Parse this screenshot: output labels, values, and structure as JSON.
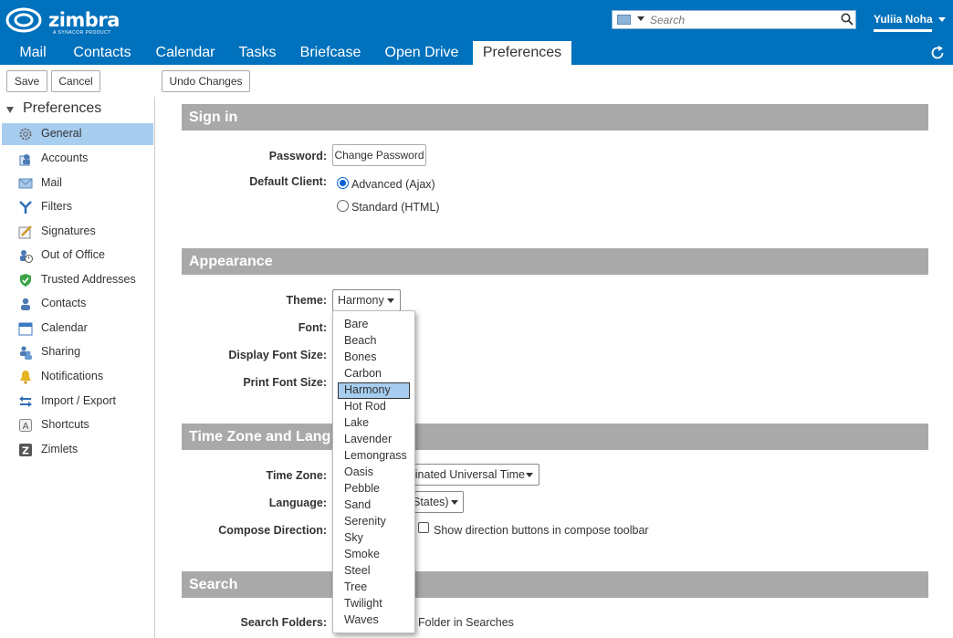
{
  "header": {
    "logo_text": "zimbra",
    "logo_subtext": "A SYNACOR PRODUCT",
    "search_placeholder": "Search",
    "user_name": "Yuliia Noha"
  },
  "tabs": [
    {
      "label": "Mail"
    },
    {
      "label": "Contacts"
    },
    {
      "label": "Calendar"
    },
    {
      "label": "Tasks"
    },
    {
      "label": "Briefcase"
    },
    {
      "label": "Open Drive"
    },
    {
      "label": "Preferences",
      "active": true
    }
  ],
  "toolbar": {
    "save_label": "Save",
    "cancel_label": "Cancel",
    "undo_label": "Undo Changes"
  },
  "sidebar": {
    "header": "Preferences",
    "items": [
      {
        "label": "General",
        "icon": "gear-icon",
        "selected": true
      },
      {
        "label": "Accounts",
        "icon": "accounts-icon"
      },
      {
        "label": "Mail",
        "icon": "mail-icon"
      },
      {
        "label": "Filters",
        "icon": "filter-icon"
      },
      {
        "label": "Signatures",
        "icon": "signature-icon"
      },
      {
        "label": "Out of Office",
        "icon": "out-of-office-icon"
      },
      {
        "label": "Trusted Addresses",
        "icon": "shield-icon"
      },
      {
        "label": "Contacts",
        "icon": "contact-icon"
      },
      {
        "label": "Calendar",
        "icon": "calendar-icon"
      },
      {
        "label": "Sharing",
        "icon": "sharing-icon"
      },
      {
        "label": "Notifications",
        "icon": "bell-icon"
      },
      {
        "label": "Import / Export",
        "icon": "import-export-icon"
      },
      {
        "label": "Shortcuts",
        "icon": "shortcut-icon"
      },
      {
        "label": "Zimlets",
        "icon": "zimlet-icon"
      }
    ]
  },
  "signin": {
    "title": "Sign in",
    "password_label": "Password:",
    "change_password": "Change Password",
    "default_client_label": "Default Client:",
    "advanced": "Advanced (Ajax)",
    "standard": "Standard (HTML)"
  },
  "appearance": {
    "title": "Appearance",
    "theme_label": "Theme:",
    "theme_value": "Harmony",
    "font_label": "Font:",
    "display_font_size_label": "Display Font Size:",
    "print_font_size_label": "Print Font Size:"
  },
  "timezone": {
    "title": "Time Zone and Lang",
    "tz_label": "Time Zone:",
    "tz_value": "linated Universal Time",
    "language_label": "Language:",
    "language_value": "States)",
    "compose_direction_label": "Compose Direction:",
    "compose_direction_text": "Show direction buttons in compose toolbar"
  },
  "search": {
    "title": "Search",
    "folders_label": "Search Folders:",
    "folders_text": "Folder in Searches"
  },
  "theme_options": [
    "Bare",
    "Beach",
    "Bones",
    "Carbon",
    "Harmony",
    "Hot Rod",
    "Lake",
    "Lavender",
    "Lemongrass",
    "Oasis",
    "Pebble",
    "Sand",
    "Serenity",
    "Sky",
    "Smoke",
    "Steel",
    "Tree",
    "Twilight",
    "Waves"
  ],
  "theme_selected": "Harmony",
  "colors": {
    "brand_blue": "#0071bc",
    "section_gray": "#a9a9a9",
    "selection_blue": "#a7cdef"
  }
}
